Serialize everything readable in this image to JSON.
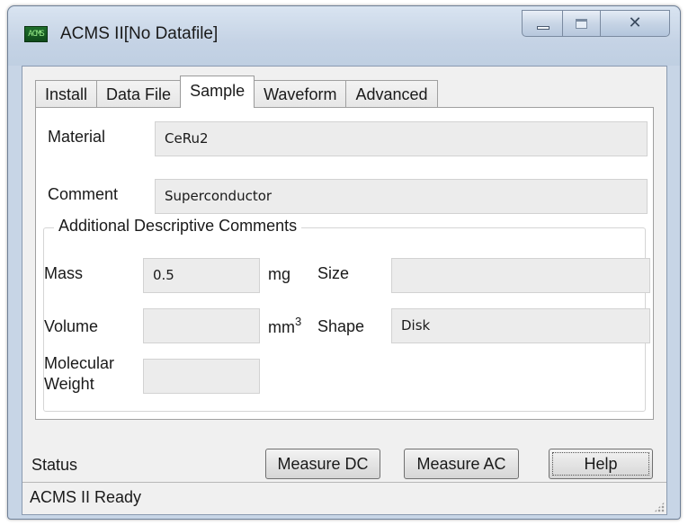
{
  "window": {
    "title": "ACMS II[No Datafile]",
    "icon": "acms-app-icon",
    "icon_glyph": "ACMS"
  },
  "tabs": [
    {
      "label": "Install",
      "active": false
    },
    {
      "label": "Data File",
      "active": false
    },
    {
      "label": "Sample",
      "active": true
    },
    {
      "label": "Waveform",
      "active": false
    },
    {
      "label": "Advanced",
      "active": false
    }
  ],
  "sample": {
    "material_label": "Material",
    "material_value": "CeRu2",
    "comment_label": "Comment",
    "comment_value": "Superconductor",
    "additional": {
      "group_title": "Additional Descriptive Comments",
      "mass_label": "Mass",
      "mass_value": "0.5",
      "mass_unit": "mg",
      "size_label": "Size",
      "size_value": "",
      "volume_label": "Volume",
      "volume_value": "",
      "volume_unit_base": "mm",
      "volume_unit_exp": "3",
      "shape_label": "Shape",
      "shape_value": "Disk",
      "molecular_weight_label_line1": "Molecular",
      "molecular_weight_label_line2": "Weight",
      "molecular_weight_value": ""
    }
  },
  "footer": {
    "status_label": "Status",
    "measure_dc_label": "Measure DC",
    "measure_ac_label": "Measure AC",
    "help_label": "Help"
  },
  "statusbar": {
    "text": "ACMS II Ready"
  }
}
